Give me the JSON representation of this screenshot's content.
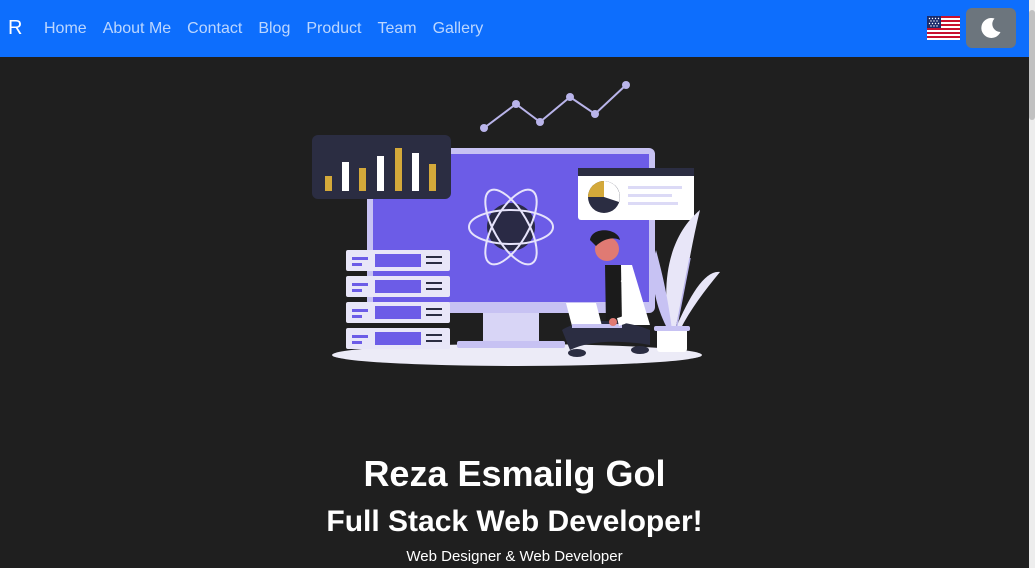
{
  "navbar": {
    "brand": "R",
    "links": [
      "Home",
      "About Me",
      "Contact",
      "Blog",
      "Product",
      "Team",
      "Gallery"
    ],
    "background": "#0d6efd",
    "language_flag_icon": "us-flag-icon",
    "theme_toggle_icon": "moon-icon"
  },
  "hero": {
    "name": "Reza Esmailg Gol",
    "title": "Full Stack Web Developer!",
    "subtitle": "Web Designer & Web Developer"
  },
  "colors": {
    "page_background": "#1f1f1f",
    "accent_purple": "#6c5ce7",
    "accent_gold": "#d4a93a"
  }
}
